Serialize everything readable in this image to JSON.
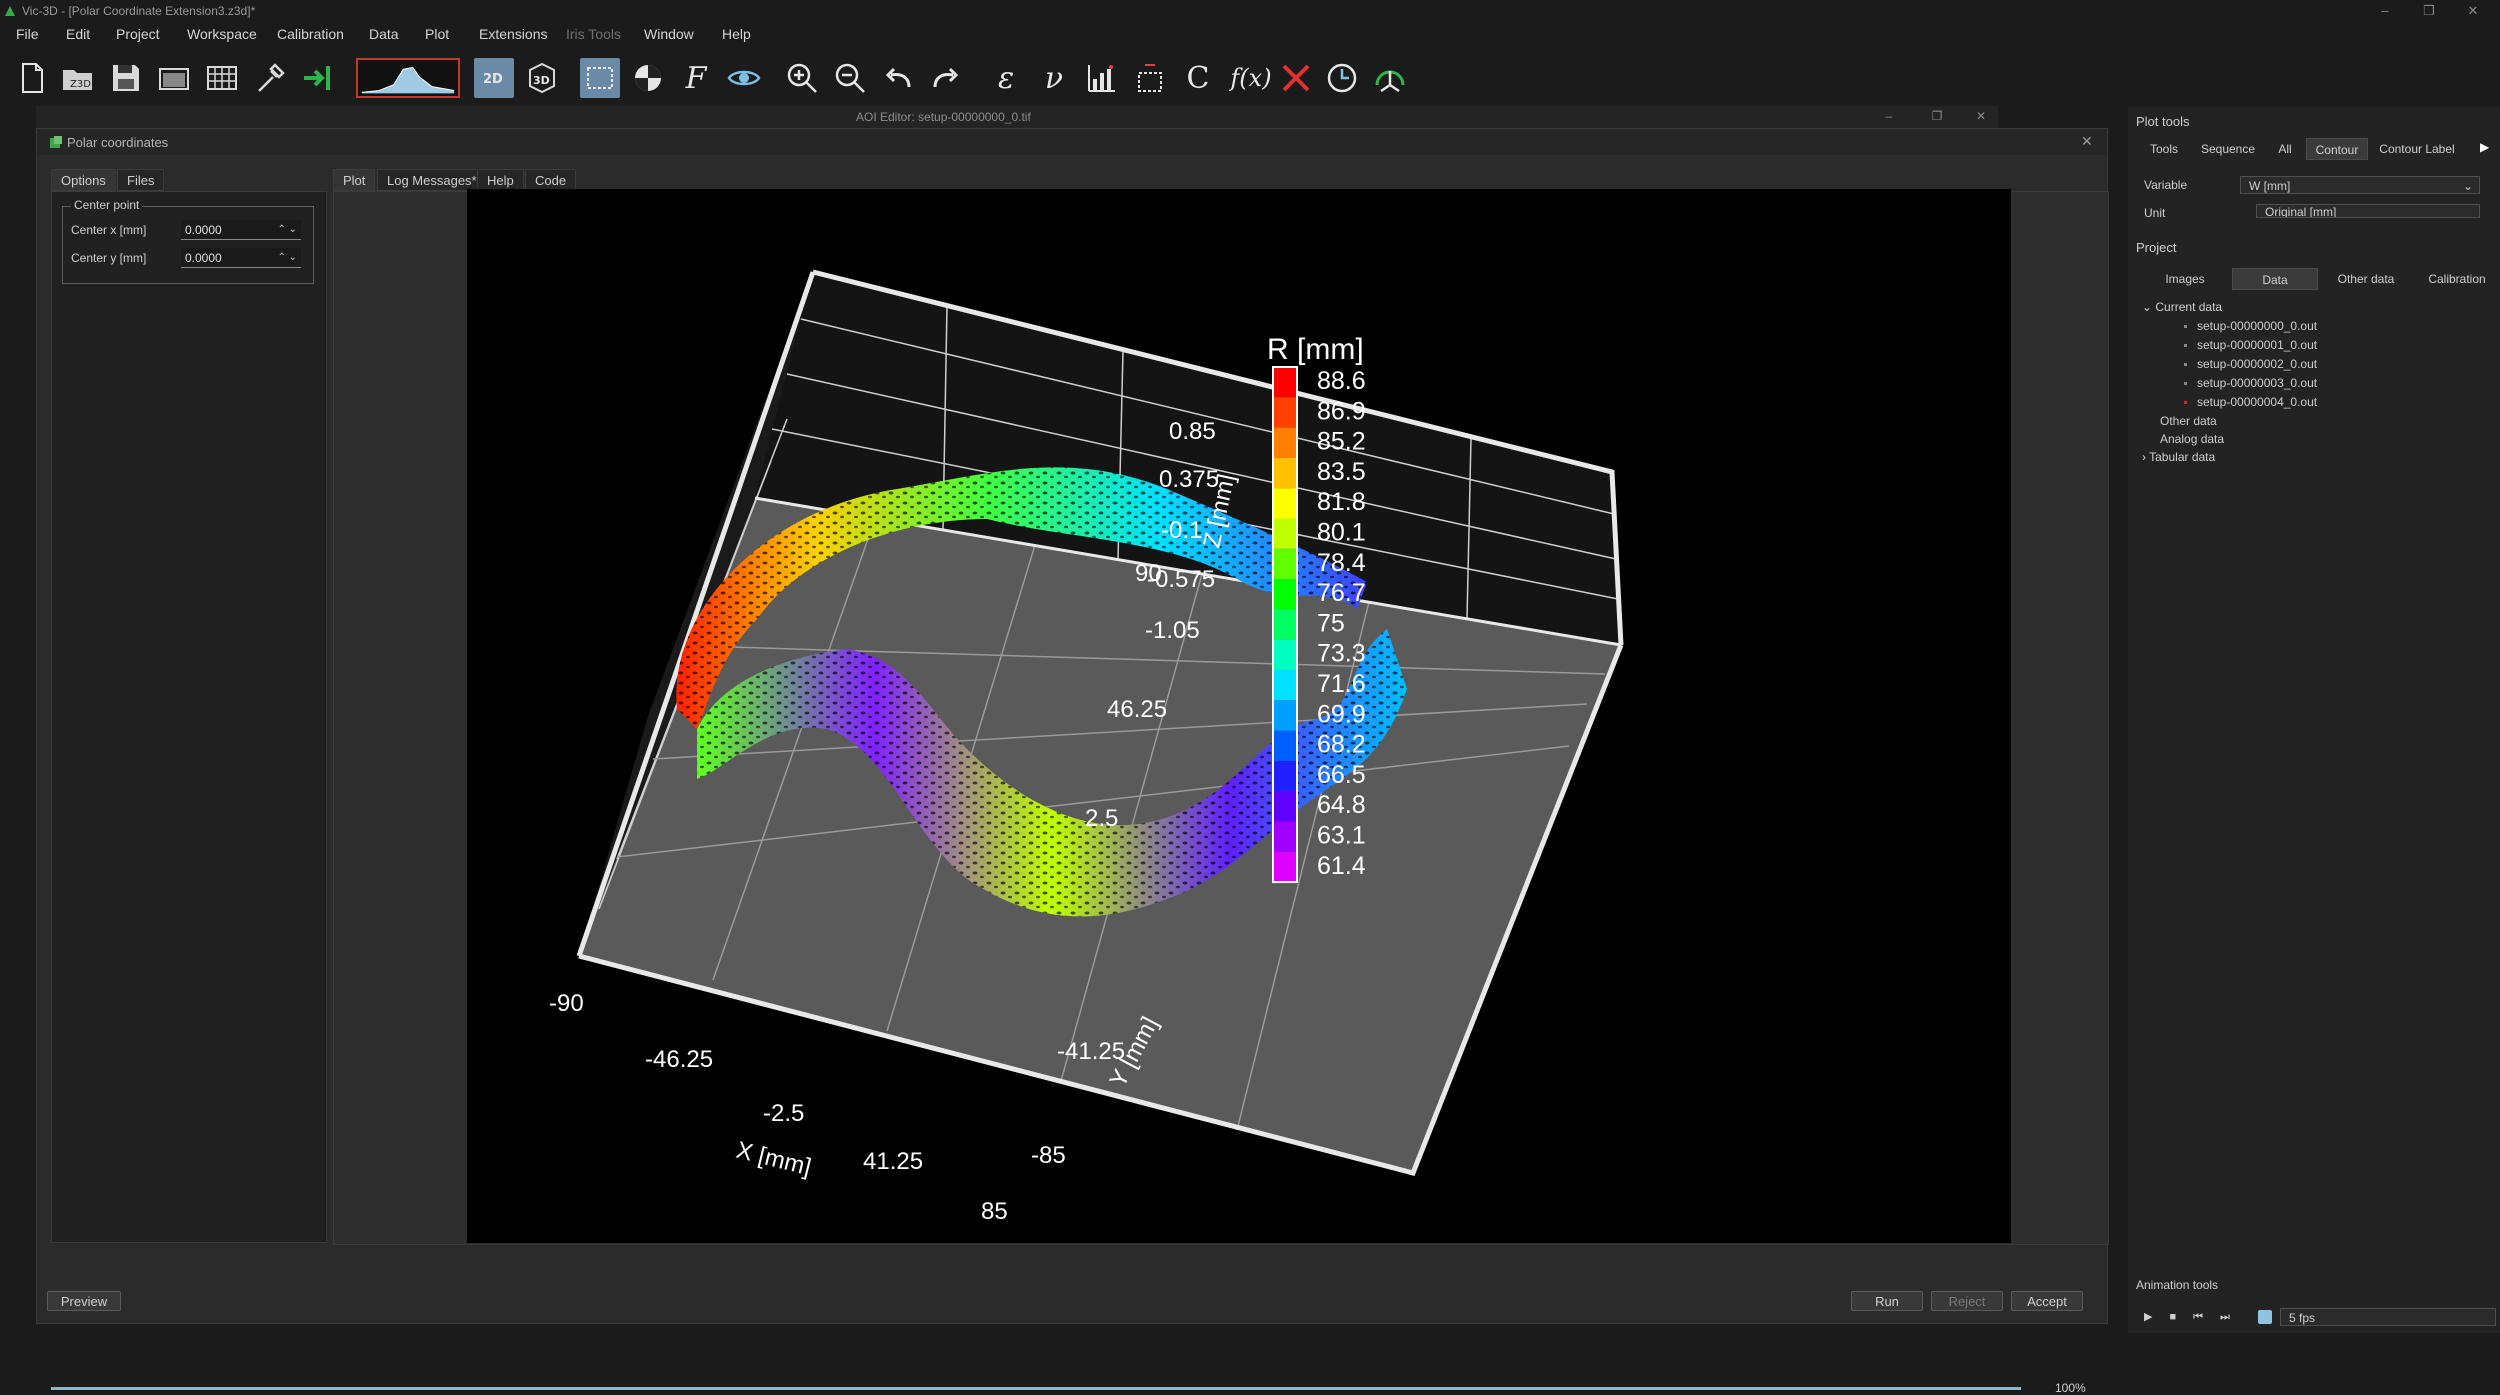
{
  "window": {
    "title": "Vic-3D - [Polar Coordinate Extension3.z3d]*"
  },
  "menu": [
    "File",
    "Edit",
    "Project",
    "Workspace",
    "Calibration",
    "Data",
    "Plot",
    "Extensions",
    "Iris Tools",
    "Window",
    "Help"
  ],
  "aoi_editor": {
    "title": "AOI Editor: setup-00000000_0.tif"
  },
  "dialog": {
    "title": "Polar coordinates",
    "left_tabs": [
      "Options",
      "Files"
    ],
    "group_title": "Center point",
    "center_x_label": "Center x [mm]",
    "center_x_value": "0.0000",
    "center_y_label": "Center y [mm]",
    "center_y_value": "0.0000",
    "right_tabs": [
      "Plot",
      "Log Messages*",
      "Help",
      "Code"
    ],
    "progress_percent": 100,
    "progress_label": "100%",
    "buttons": {
      "preview": "Preview",
      "run": "Run",
      "reject": "Reject",
      "accept": "Accept"
    }
  },
  "plot": {
    "colorbar_title": "R [mm]",
    "colorbar_labels": [
      "88.6",
      "86.9",
      "85.2",
      "83.5",
      "81.8",
      "80.1",
      "78.4",
      "76.7",
      "75",
      "73.3",
      "71.6",
      "69.9",
      "68.2",
      "66.5",
      "64.8",
      "63.1",
      "61.4"
    ],
    "colorbar_colors": [
      "#ff0000",
      "#ff4000",
      "#ff8000",
      "#ffc000",
      "#ffff00",
      "#c0ff00",
      "#60ff00",
      "#00ff00",
      "#00ff60",
      "#00ffc0",
      "#00e0ff",
      "#00a0ff",
      "#0060ff",
      "#2020ff",
      "#6000ff",
      "#a000ff",
      "#e000ff"
    ],
    "x_label": "X [mm]",
    "x_ticks": [
      "-90",
      "-46.25",
      "-2.5",
      "41.25",
      "85"
    ],
    "y_label": "Y [mm]",
    "y_ticks": [
      "90",
      "46.25",
      "2.5",
      "-41.25",
      "-85"
    ],
    "z_label": "Z [mm]",
    "z_ticks": [
      "0.85",
      "0.375",
      "-0.1",
      "-0.575",
      "-1.05"
    ]
  },
  "right_panel": {
    "plot_tools_title": "Plot tools",
    "plot_tool_tabs": [
      "Tools",
      "Sequence",
      "All",
      "Contour",
      "Contour Label"
    ],
    "variable_label": "Variable",
    "variable_value": "W [mm]",
    "unit_label": "Unit",
    "unit_value": "Original [mm]",
    "project_title": "Project",
    "project_tabs": [
      "Images",
      "Data",
      "Other data",
      "Calibration"
    ],
    "tree": {
      "current_data": "Current data",
      "files": [
        "setup-00000000_0.out",
        "setup-00000001_0.out",
        "setup-00000002_0.out",
        "setup-00000003_0.out",
        "setup-00000004_0.out"
      ],
      "other_data": "Other data",
      "analog_data": "Analog data",
      "tabular_data": "Tabular data"
    },
    "animation_title": "Animation tools",
    "fps_value": "5 fps"
  }
}
